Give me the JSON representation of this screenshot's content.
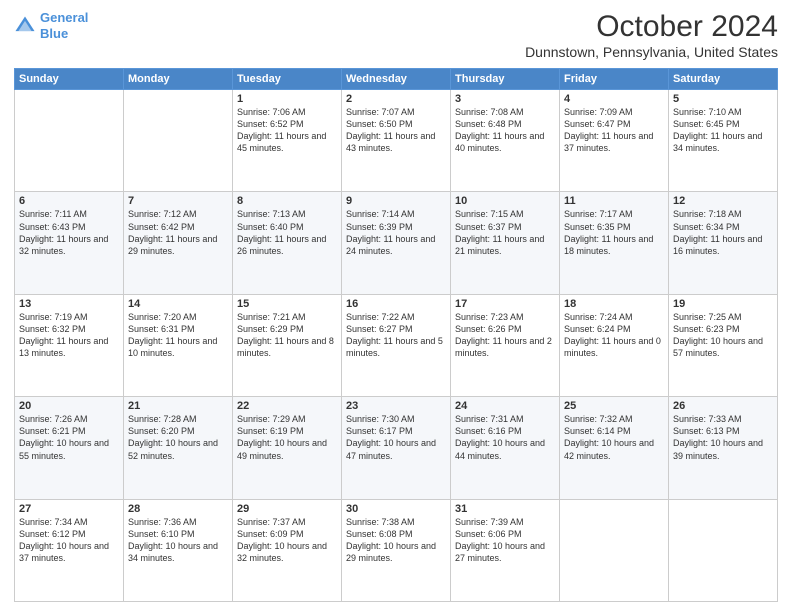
{
  "header": {
    "logo_line1": "General",
    "logo_line2": "Blue",
    "title": "October 2024",
    "subtitle": "Dunnstown, Pennsylvania, United States"
  },
  "weekdays": [
    "Sunday",
    "Monday",
    "Tuesday",
    "Wednesday",
    "Thursday",
    "Friday",
    "Saturday"
  ],
  "rows": [
    [
      {
        "day": "",
        "info": ""
      },
      {
        "day": "",
        "info": ""
      },
      {
        "day": "1",
        "info": "Sunrise: 7:06 AM\nSunset: 6:52 PM\nDaylight: 11 hours and 45 minutes."
      },
      {
        "day": "2",
        "info": "Sunrise: 7:07 AM\nSunset: 6:50 PM\nDaylight: 11 hours and 43 minutes."
      },
      {
        "day": "3",
        "info": "Sunrise: 7:08 AM\nSunset: 6:48 PM\nDaylight: 11 hours and 40 minutes."
      },
      {
        "day": "4",
        "info": "Sunrise: 7:09 AM\nSunset: 6:47 PM\nDaylight: 11 hours and 37 minutes."
      },
      {
        "day": "5",
        "info": "Sunrise: 7:10 AM\nSunset: 6:45 PM\nDaylight: 11 hours and 34 minutes."
      }
    ],
    [
      {
        "day": "6",
        "info": "Sunrise: 7:11 AM\nSunset: 6:43 PM\nDaylight: 11 hours and 32 minutes."
      },
      {
        "day": "7",
        "info": "Sunrise: 7:12 AM\nSunset: 6:42 PM\nDaylight: 11 hours and 29 minutes."
      },
      {
        "day": "8",
        "info": "Sunrise: 7:13 AM\nSunset: 6:40 PM\nDaylight: 11 hours and 26 minutes."
      },
      {
        "day": "9",
        "info": "Sunrise: 7:14 AM\nSunset: 6:39 PM\nDaylight: 11 hours and 24 minutes."
      },
      {
        "day": "10",
        "info": "Sunrise: 7:15 AM\nSunset: 6:37 PM\nDaylight: 11 hours and 21 minutes."
      },
      {
        "day": "11",
        "info": "Sunrise: 7:17 AM\nSunset: 6:35 PM\nDaylight: 11 hours and 18 minutes."
      },
      {
        "day": "12",
        "info": "Sunrise: 7:18 AM\nSunset: 6:34 PM\nDaylight: 11 hours and 16 minutes."
      }
    ],
    [
      {
        "day": "13",
        "info": "Sunrise: 7:19 AM\nSunset: 6:32 PM\nDaylight: 11 hours and 13 minutes."
      },
      {
        "day": "14",
        "info": "Sunrise: 7:20 AM\nSunset: 6:31 PM\nDaylight: 11 hours and 10 minutes."
      },
      {
        "day": "15",
        "info": "Sunrise: 7:21 AM\nSunset: 6:29 PM\nDaylight: 11 hours and 8 minutes."
      },
      {
        "day": "16",
        "info": "Sunrise: 7:22 AM\nSunset: 6:27 PM\nDaylight: 11 hours and 5 minutes."
      },
      {
        "day": "17",
        "info": "Sunrise: 7:23 AM\nSunset: 6:26 PM\nDaylight: 11 hours and 2 minutes."
      },
      {
        "day": "18",
        "info": "Sunrise: 7:24 AM\nSunset: 6:24 PM\nDaylight: 11 hours and 0 minutes."
      },
      {
        "day": "19",
        "info": "Sunrise: 7:25 AM\nSunset: 6:23 PM\nDaylight: 10 hours and 57 minutes."
      }
    ],
    [
      {
        "day": "20",
        "info": "Sunrise: 7:26 AM\nSunset: 6:21 PM\nDaylight: 10 hours and 55 minutes."
      },
      {
        "day": "21",
        "info": "Sunrise: 7:28 AM\nSunset: 6:20 PM\nDaylight: 10 hours and 52 minutes."
      },
      {
        "day": "22",
        "info": "Sunrise: 7:29 AM\nSunset: 6:19 PM\nDaylight: 10 hours and 49 minutes."
      },
      {
        "day": "23",
        "info": "Sunrise: 7:30 AM\nSunset: 6:17 PM\nDaylight: 10 hours and 47 minutes."
      },
      {
        "day": "24",
        "info": "Sunrise: 7:31 AM\nSunset: 6:16 PM\nDaylight: 10 hours and 44 minutes."
      },
      {
        "day": "25",
        "info": "Sunrise: 7:32 AM\nSunset: 6:14 PM\nDaylight: 10 hours and 42 minutes."
      },
      {
        "day": "26",
        "info": "Sunrise: 7:33 AM\nSunset: 6:13 PM\nDaylight: 10 hours and 39 minutes."
      }
    ],
    [
      {
        "day": "27",
        "info": "Sunrise: 7:34 AM\nSunset: 6:12 PM\nDaylight: 10 hours and 37 minutes."
      },
      {
        "day": "28",
        "info": "Sunrise: 7:36 AM\nSunset: 6:10 PM\nDaylight: 10 hours and 34 minutes."
      },
      {
        "day": "29",
        "info": "Sunrise: 7:37 AM\nSunset: 6:09 PM\nDaylight: 10 hours and 32 minutes."
      },
      {
        "day": "30",
        "info": "Sunrise: 7:38 AM\nSunset: 6:08 PM\nDaylight: 10 hours and 29 minutes."
      },
      {
        "day": "31",
        "info": "Sunrise: 7:39 AM\nSunset: 6:06 PM\nDaylight: 10 hours and 27 minutes."
      },
      {
        "day": "",
        "info": ""
      },
      {
        "day": "",
        "info": ""
      }
    ]
  ]
}
